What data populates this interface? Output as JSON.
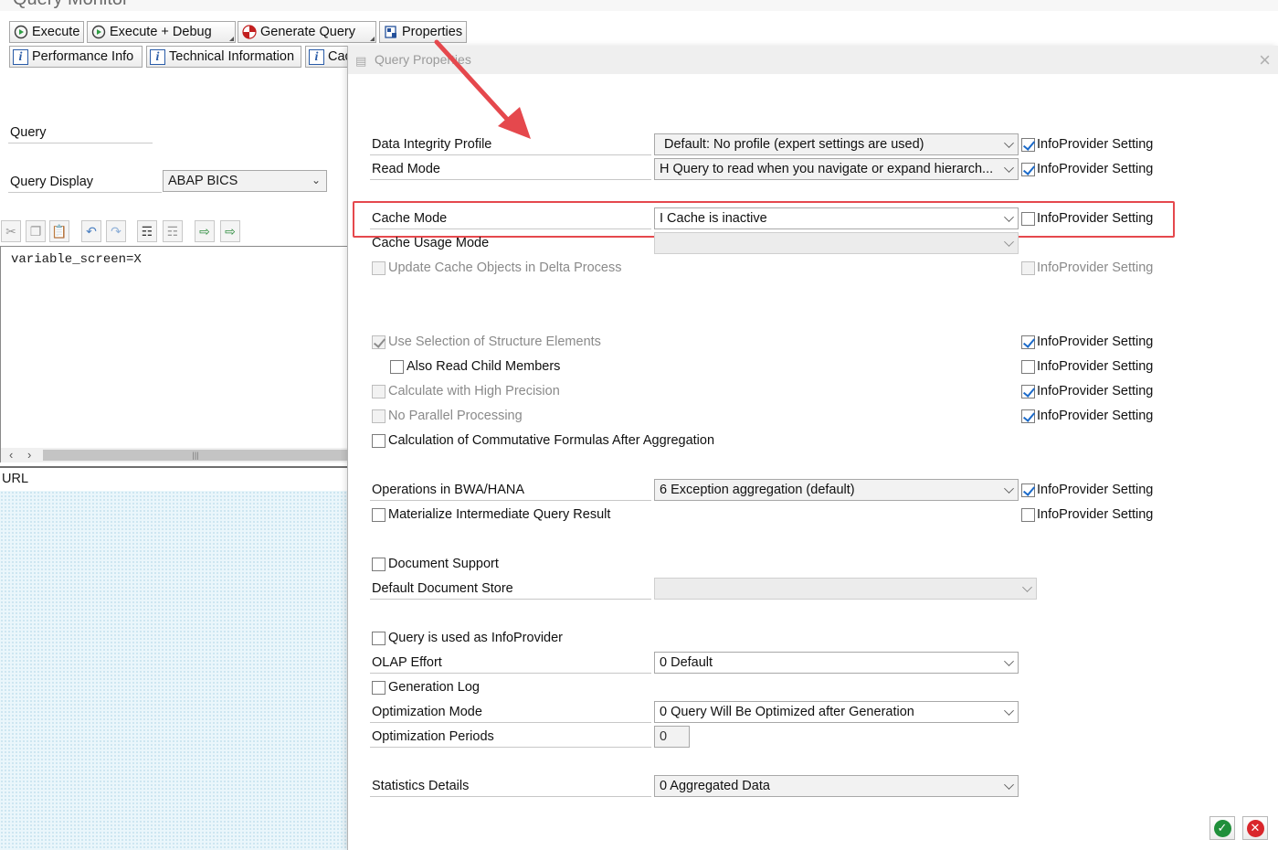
{
  "window": {
    "title": "Query Monitor"
  },
  "toolbar": {
    "row1": [
      {
        "label": "Execute",
        "icon": "execute-icon"
      },
      {
        "label": "Execute + Debug",
        "icon": "execute-debug-icon"
      },
      {
        "label": "Generate Query",
        "icon": "generate-query-icon"
      },
      {
        "label": "Properties",
        "icon": "properties-icon"
      }
    ],
    "row2": [
      {
        "label": "Performance Info",
        "icon": "info-icon"
      },
      {
        "label": "Technical Information",
        "icon": "info-icon"
      },
      {
        "label": "Cac",
        "icon": "info-icon"
      }
    ]
  },
  "left": {
    "query_label": "Query",
    "query_display_label": "Query Display",
    "query_display_value": "ABAP BICS",
    "editor_text": "variable_screen=X",
    "url_label": "URL"
  },
  "dialog": {
    "title": "Query Properties",
    "infoprovider_label": "InfoProvider Setting",
    "rows": {
      "data_integrity": {
        "label": "Data Integrity Profile",
        "value": "Default: No profile (expert settings are used)",
        "ip_checked": true
      },
      "read_mode": {
        "label": "Read Mode",
        "value": "H Query to read when you navigate or expand hierarch...",
        "ip_checked": true
      },
      "cache_mode": {
        "label": "Cache Mode",
        "value": "I Cache is inactive",
        "ip_checked": false
      },
      "cache_usage": {
        "label": "Cache Usage Mode",
        "value": ""
      },
      "update_cache": {
        "label": "Update Cache Objects in Delta Process",
        "checked": false,
        "ip_checked": false
      },
      "use_selection": {
        "label": "Use Selection of Structure Elements",
        "checked": true,
        "ip_checked": true
      },
      "child_members": {
        "label": "Also Read Child Members",
        "checked": false,
        "ip_checked": false
      },
      "high_precision": {
        "label": "Calculate with High Precision",
        "checked": false,
        "ip_checked": true
      },
      "no_parallel": {
        "label": "No Parallel Processing",
        "checked": false,
        "ip_checked": true
      },
      "commutative": {
        "label": "Calculation of Commutative Formulas After Aggregation",
        "checked": false
      },
      "operations": {
        "label": "Operations in BWA/HANA",
        "value": "6 Exception aggregation (default)",
        "ip_checked": true
      },
      "materialize": {
        "label": "Materialize Intermediate Query Result",
        "checked": false,
        "ip_checked": false
      },
      "document_support": {
        "label": "Document Support",
        "checked": false
      },
      "document_store": {
        "label": "Default Document Store",
        "value": ""
      },
      "infoprovider_query": {
        "label": "Query is used as InfoProvider",
        "checked": false
      },
      "olap_effort": {
        "label": "OLAP Effort",
        "value": "0 Default"
      },
      "generation_log": {
        "label": "Generation Log",
        "checked": false
      },
      "optimization_mode": {
        "label": "Optimization Mode",
        "value": "0 Query Will Be Optimized after Generation"
      },
      "optimization_periods": {
        "label": "Optimization Periods",
        "value": "0"
      },
      "statistics": {
        "label": "Statistics Details",
        "value": "0 Aggregated Data"
      }
    }
  },
  "colors": {
    "highlight": "#e5484d",
    "checkmark": "#1b6ac9",
    "ok": "#1f8f3a",
    "cancel": "#d9262b"
  }
}
